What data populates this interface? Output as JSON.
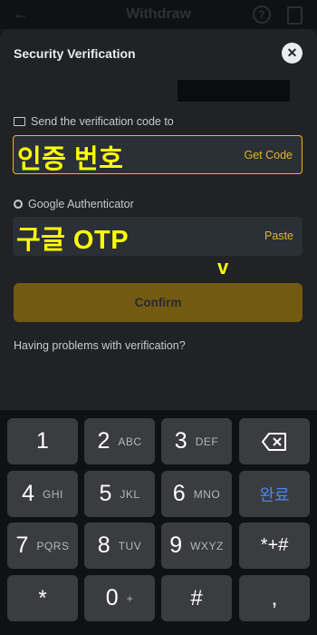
{
  "topbar": {
    "title": "Withdraw"
  },
  "sheet": {
    "title": "Security Verification",
    "email_label": "Send the verification code to",
    "email_overlay": "인증 번호",
    "get_code": "Get Code",
    "ga_label": "Google Authenticator",
    "ga_overlay": "구글 OTP",
    "paste": "Paste",
    "v_mark": "v",
    "confirm": "Confirm",
    "problems": "Having problems with verification?"
  },
  "keypad": {
    "keys": [
      {
        "num": "1",
        "letters": ""
      },
      {
        "num": "2",
        "letters": "ABC"
      },
      {
        "num": "3",
        "letters": "DEF"
      },
      {
        "num": "4",
        "letters": "GHI"
      },
      {
        "num": "5",
        "letters": "JKL"
      },
      {
        "num": "6",
        "letters": "MNO"
      },
      {
        "num": "7",
        "letters": "PQRS"
      },
      {
        "num": "8",
        "letters": "TUV"
      },
      {
        "num": "9",
        "letters": "WXYZ"
      },
      {
        "num": "0",
        "letters": "+"
      }
    ],
    "done": "완료",
    "symbols": "*+#",
    "star": "*",
    "hash": "#",
    "comma": ","
  }
}
